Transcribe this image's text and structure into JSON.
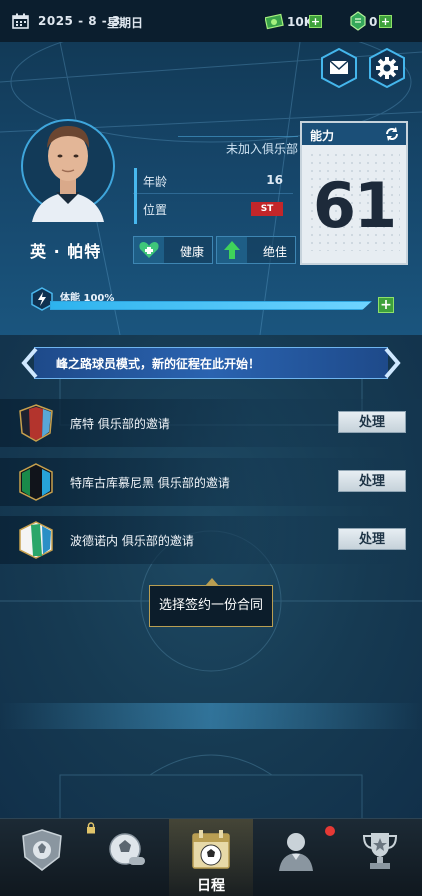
{
  "topbar": {
    "date": "2025 - 8 - 3",
    "weekday": "星期日",
    "cash": "10K",
    "gems": "0",
    "plus": "+"
  },
  "player": {
    "name": "英 · 帕特",
    "club_status": "未加入俱乐部",
    "age_label": "年龄",
    "age": "16",
    "position_label": "位置",
    "position": "ST",
    "health": "健康",
    "form": "绝佳",
    "ability_label": "能力",
    "ability": "61",
    "stamina_label": "体能 100%",
    "stamina": 1.0
  },
  "banner": {
    "text": "峰之路球员模式，新的征程在此开始！"
  },
  "invites": [
    {
      "text": "席特 俱乐部的邀请",
      "button": "处理",
      "colors": [
        "#1d2230",
        "#b3342d",
        "#58a7d8"
      ]
    },
    {
      "text": "特库古库慕尼黑 俱乐部的邀请",
      "button": "处理",
      "colors": [
        "#1a8a4a",
        "#11141b",
        "#27a3d8"
      ]
    },
    {
      "text": "波德诺内 俱乐部的邀请",
      "button": "处理",
      "colors": [
        "#f4f4f4",
        "#2aa66a",
        "#2a8fc6"
      ]
    }
  ],
  "tooltip": "选择签约一份合同",
  "nav": {
    "items": [
      {
        "icon": "crest-shield-icon"
      },
      {
        "icon": "ball-whistle-icon"
      },
      {
        "icon": "calendar-ball-icon",
        "label": "日程"
      },
      {
        "icon": "player-icon"
      },
      {
        "icon": "trophy-icon"
      }
    ]
  },
  "colors": {
    "accent": "#2db3ee",
    "gold": "#b99e52",
    "red": "#c3262a"
  }
}
